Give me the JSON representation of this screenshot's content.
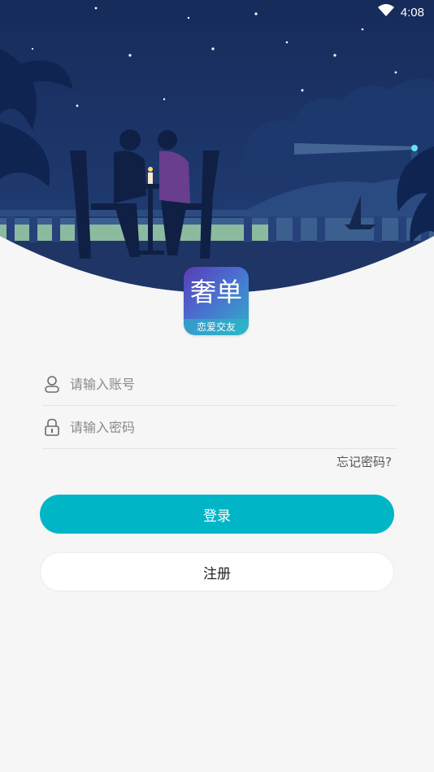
{
  "status_bar": {
    "time": "4:08",
    "wifi_icon": "wifi-icon",
    "battery_icon": "battery-icon"
  },
  "logo": {
    "title": "奢单",
    "subtitle": "恋爱交友"
  },
  "form": {
    "account": {
      "placeholder": "请输入账号",
      "value": "",
      "icon": "user-icon"
    },
    "password": {
      "placeholder": "请输入密码",
      "value": "",
      "icon": "lock-icon"
    },
    "forgot_label": "忘记密码?"
  },
  "buttons": {
    "login_label": "登录",
    "register_label": "注册"
  },
  "colors": {
    "accent": "#00b6c6",
    "night_sky": "#1b3264",
    "background": "#f6f6f6"
  }
}
